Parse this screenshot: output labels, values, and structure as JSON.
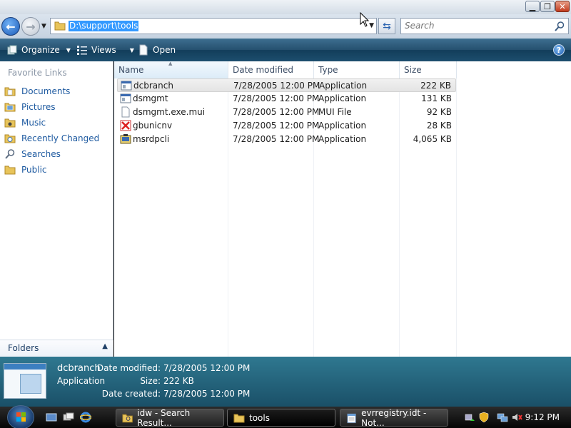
{
  "address": {
    "path": "D:\\support\\tools"
  },
  "search": {
    "placeholder": "Search"
  },
  "toolbar": {
    "organize": "Organize",
    "views": "Views",
    "open": "Open",
    "help": "?"
  },
  "navigation": {
    "header": "Favorite Links",
    "items": [
      {
        "label": "Documents",
        "icon": "documents-folder-icon"
      },
      {
        "label": "Pictures",
        "icon": "pictures-folder-icon"
      },
      {
        "label": "Music",
        "icon": "music-folder-icon"
      },
      {
        "label": "Recently Changed",
        "icon": "recently-changed-folder-icon"
      },
      {
        "label": "Searches",
        "icon": "search-folder-icon"
      },
      {
        "label": "Public",
        "icon": "public-folder-icon"
      }
    ],
    "folders_label": "Folders"
  },
  "columns": [
    "Name",
    "Date modified",
    "Type",
    "Size"
  ],
  "files": [
    {
      "name": "dcbranch",
      "date": "7/28/2005 12:00 PM",
      "type": "Application",
      "size": "222 KB",
      "icon": "application-icon",
      "selected": true
    },
    {
      "name": "dsmgmt",
      "date": "7/28/2005 12:00 PM",
      "type": "Application",
      "size": "131 KB",
      "icon": "application-icon",
      "selected": false
    },
    {
      "name": "dsmgmt.exe.mui",
      "date": "7/28/2005 12:00 PM",
      "type": "MUI File",
      "size": "92 KB",
      "icon": "file-icon",
      "selected": false
    },
    {
      "name": "gbunicnv",
      "date": "7/28/2005 12:00 PM",
      "type": "Application",
      "size": "28 KB",
      "icon": "gbunicnv-app-icon",
      "selected": false
    },
    {
      "name": "msrdpcli",
      "date": "7/28/2005 12:00 PM",
      "type": "Application",
      "size": "4,065 KB",
      "icon": "msrdpcli-app-icon",
      "selected": false
    }
  ],
  "details": {
    "name": "dcbranch",
    "type": "Application",
    "date_modified_label": "Date modified:",
    "date_modified": "7/28/2005 12:00 PM",
    "size_label": "Size:",
    "size": "222 KB",
    "date_created_label": "Date created:",
    "date_created": "7/28/2005 12:00 PM"
  },
  "taskbar": {
    "buttons": [
      {
        "label": "idw - Search Result...",
        "icon": "folder-search-icon"
      },
      {
        "label": "tools",
        "icon": "folder-icon"
      },
      {
        "label": "evrregistry.idt - Not...",
        "icon": "notepad-icon"
      }
    ],
    "clock": "9:12 PM"
  },
  "colors": {
    "toolbar": "#25506f",
    "details_pane": "#1a5068",
    "link": "#1e5aa0",
    "selection": "#3399ff"
  }
}
